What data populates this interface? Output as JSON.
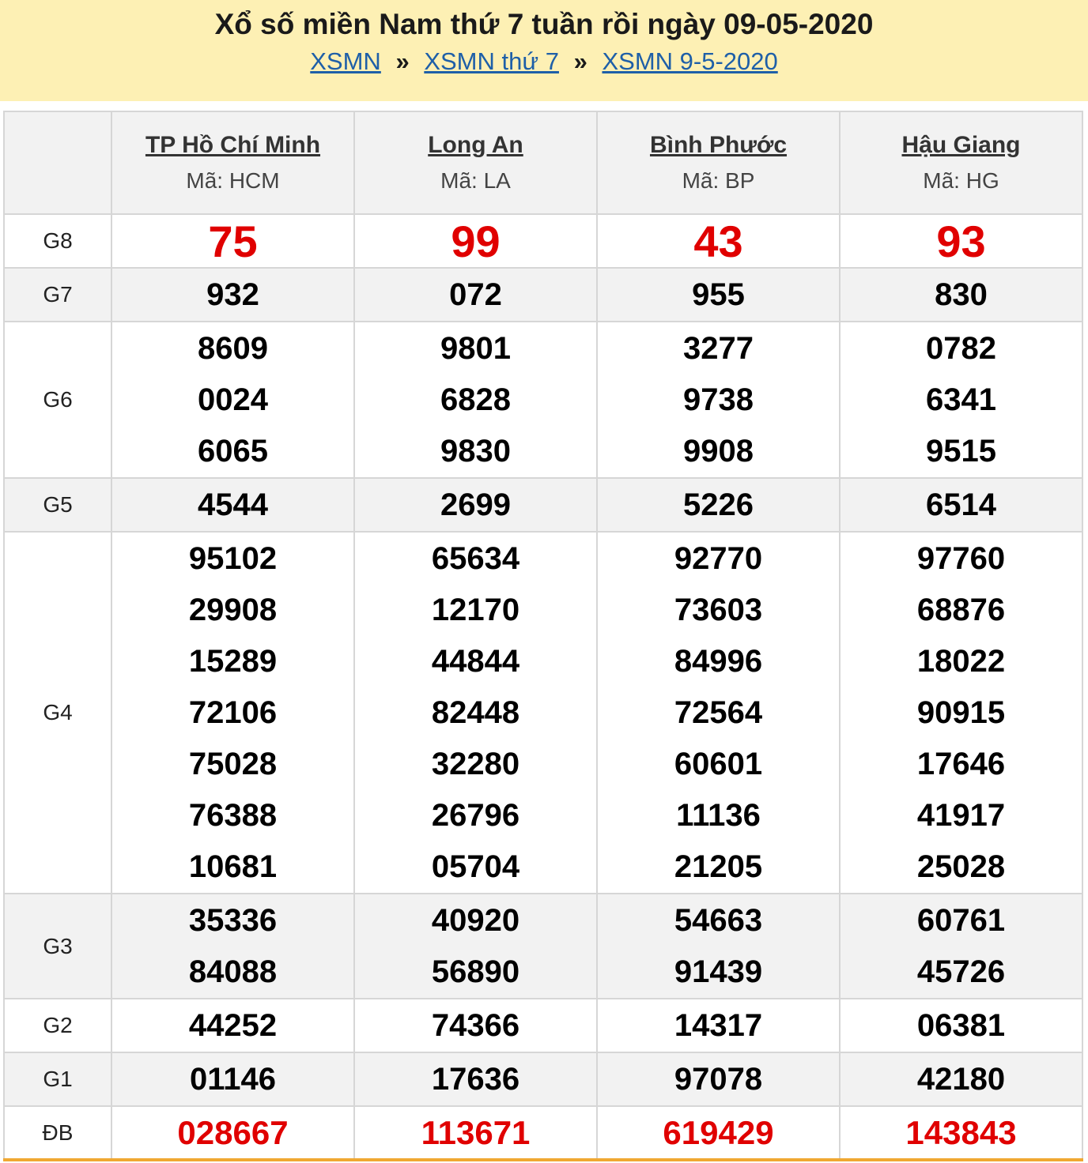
{
  "header": {
    "title": "Xổ số miền Nam thứ 7 tuần rồi ngày 09-05-2020",
    "breadcrumbs": [
      "XSMN",
      "XSMN thứ 7",
      "XSMN 9-5-2020"
    ],
    "separator": "»"
  },
  "provinces": [
    {
      "name": "TP Hồ Chí Minh",
      "code": "Mã: HCM"
    },
    {
      "name": "Long An",
      "code": "Mã: LA"
    },
    {
      "name": "Bình Phước",
      "code": "Mã: BP"
    },
    {
      "name": "Hậu Giang",
      "code": "Mã: HG"
    }
  ],
  "prizes": [
    {
      "label": "G8",
      "values": [
        [
          "75"
        ],
        [
          "99"
        ],
        [
          "43"
        ],
        [
          "93"
        ]
      ]
    },
    {
      "label": "G7",
      "values": [
        [
          "932"
        ],
        [
          "072"
        ],
        [
          "955"
        ],
        [
          "830"
        ]
      ]
    },
    {
      "label": "G6",
      "values": [
        [
          "8609",
          "0024",
          "6065"
        ],
        [
          "9801",
          "6828",
          "9830"
        ],
        [
          "3277",
          "9738",
          "9908"
        ],
        [
          "0782",
          "6341",
          "9515"
        ]
      ]
    },
    {
      "label": "G5",
      "values": [
        [
          "4544"
        ],
        [
          "2699"
        ],
        [
          "5226"
        ],
        [
          "6514"
        ]
      ]
    },
    {
      "label": "G4",
      "values": [
        [
          "95102",
          "29908",
          "15289",
          "72106",
          "75028",
          "76388",
          "10681"
        ],
        [
          "65634",
          "12170",
          "44844",
          "82448",
          "32280",
          "26796",
          "05704"
        ],
        [
          "92770",
          "73603",
          "84996",
          "72564",
          "60601",
          "11136",
          "21205"
        ],
        [
          "97760",
          "68876",
          "18022",
          "90915",
          "17646",
          "41917",
          "25028"
        ]
      ]
    },
    {
      "label": "G3",
      "values": [
        [
          "35336",
          "84088"
        ],
        [
          "40920",
          "56890"
        ],
        [
          "54663",
          "91439"
        ],
        [
          "60761",
          "45726"
        ]
      ]
    },
    {
      "label": "G2",
      "values": [
        [
          "44252"
        ],
        [
          "74366"
        ],
        [
          "14317"
        ],
        [
          "06381"
        ]
      ]
    },
    {
      "label": "G1",
      "values": [
        [
          "01146"
        ],
        [
          "17636"
        ],
        [
          "97078"
        ],
        [
          "42180"
        ]
      ]
    },
    {
      "label": "ĐB",
      "values": [
        [
          "028667"
        ],
        [
          "113671"
        ],
        [
          "619429"
        ],
        [
          "143843"
        ]
      ]
    }
  ],
  "colors": {
    "header_bg": "#fdf0b4",
    "link": "#1e5fa8",
    "highlight": "#e00000",
    "alt_row": "#f2f2f2",
    "bottom_border": "#f0a832"
  }
}
